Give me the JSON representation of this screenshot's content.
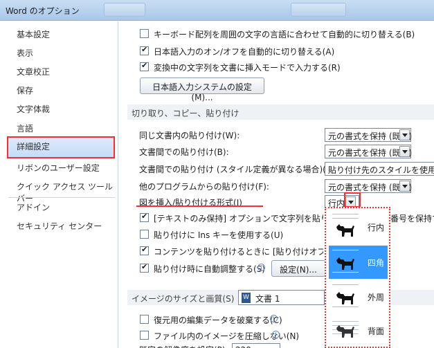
{
  "window": {
    "title": "Word のオプション"
  },
  "sidebar": {
    "items": [
      {
        "label": "基本設定"
      },
      {
        "label": "表示"
      },
      {
        "label": "文章校正"
      },
      {
        "label": "保存"
      },
      {
        "label": "文字体裁"
      },
      {
        "label": "言語"
      },
      {
        "label": "詳細設定",
        "selected": true
      },
      {
        "label": "リボンのユーザー設定"
      },
      {
        "label": "クイック アクセス ツール バー"
      },
      {
        "label": "アドイン"
      },
      {
        "label": "セキュリティ センター"
      }
    ]
  },
  "editing": {
    "opt1": {
      "label": "キーボード配列を周囲の文字の言語に合わせて自動的に切り替える(B)",
      "checked": false
    },
    "opt2": {
      "label": "日本語入力のオン/オフを自動的に切り替える(A)",
      "checked": true
    },
    "opt3": {
      "label": "変換中の文字列を文書に挿入モードで入力する(R)",
      "checked": true
    },
    "ime_button": "日本語入力システムの設定(M)..."
  },
  "paste_section": {
    "title": "切り取り、コピー、貼り付け",
    "rows": [
      {
        "label": "同じ文書内の貼り付け(W):",
        "value": "元の書式を保持 (既定)"
      },
      {
        "label": "文書間での貼り付け(B):",
        "value": "元の書式を保持 (既定)"
      },
      {
        "label": "文書間での貼り付け (スタイル定義が異なる場合)(E):",
        "value": "貼り付け先のスタイルを使用 (既"
      },
      {
        "label": "他のプログラムからの貼り付け(F):",
        "value": "元の書式を保持 (既定)"
      },
      {
        "label": "図を挿入/貼り付ける形式(I)",
        "value": "行内"
      }
    ],
    "checks": [
      {
        "label": "[テキストのみ保持] オプションで文字列を貼り付けるとき",
        "checked": true
      },
      {
        "label": "貼り付けに Ins キーを使用する(U)",
        "checked": false
      },
      {
        "label": "コンテンツを貼り付けるときに [貼り付けオプション] ボタ",
        "checked": true
      },
      {
        "label": "貼り付け時に自動調整する(S)",
        "checked": true
      }
    ],
    "trailing_text": "番号を保持す",
    "settings_button": "設定(N)..."
  },
  "image_section": {
    "title": "イメージのサイズと画質(S)",
    "document": "文書 1",
    "checks": [
      {
        "label": "復元用の編集データを破棄する(C)",
        "checked": false
      },
      {
        "label": "ファイル内のイメージを圧縮しない(N)",
        "checked": false
      }
    ],
    "partial_label": "既定の解像度を設定(P):",
    "partial_value": "220"
  },
  "wrap_dropdown": {
    "options": [
      {
        "label": "行内",
        "icon": "inline-dog-icon"
      },
      {
        "label": "四角",
        "icon": "square-dog-icon",
        "selected": true
      },
      {
        "label": "外周",
        "icon": "tight-dog-icon"
      },
      {
        "label": "背面",
        "icon": "behind-dog-icon"
      }
    ]
  },
  "colors": {
    "highlight": "#3399ff",
    "annotation": "#ff2b2b",
    "section_bg": "#eef1f5"
  }
}
